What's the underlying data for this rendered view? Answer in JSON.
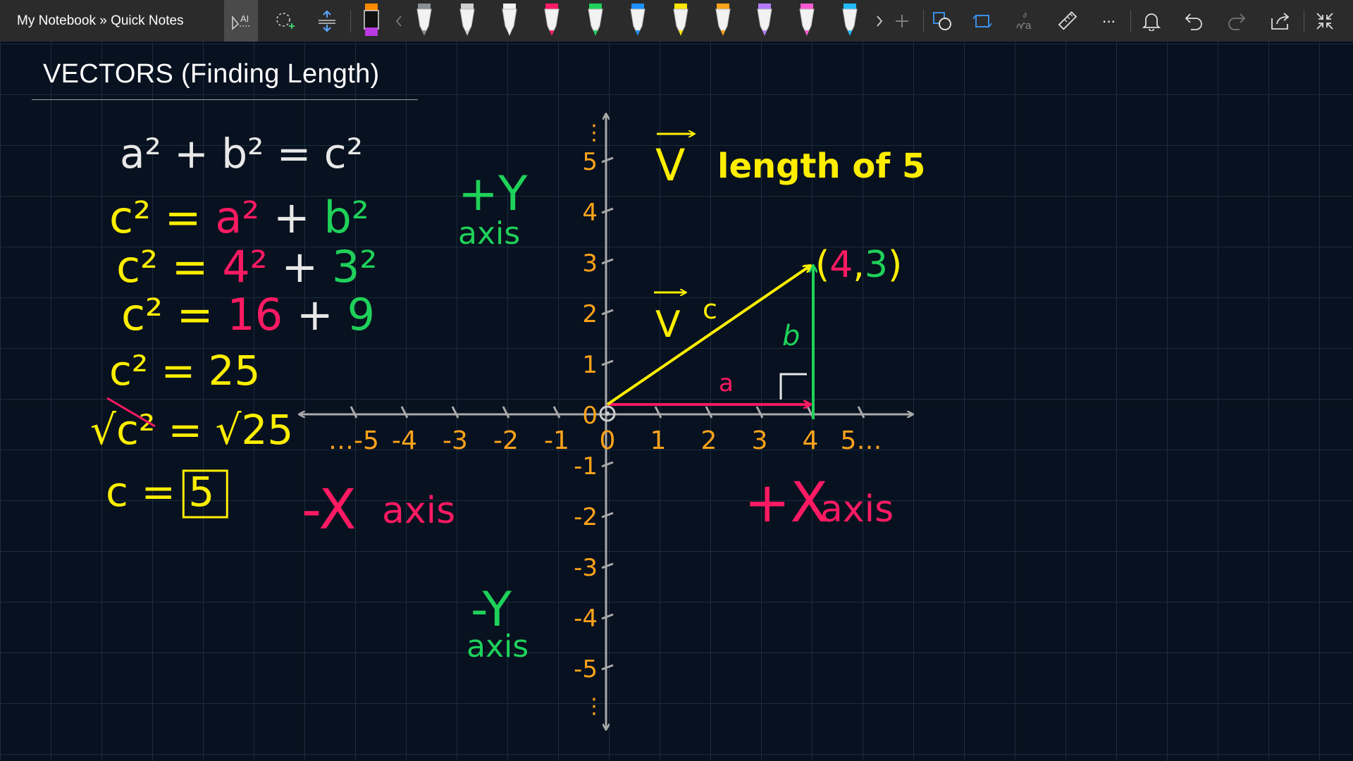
{
  "app": {
    "breadcrumb": "My Notebook » Quick Notes",
    "colors": {
      "toolbar_bg": "#2b2b2b",
      "canvas_bg": "#07111f",
      "grid_line": "#1c2c3d",
      "ink_white": "#e8e8e8",
      "ink_yellow": "#ffee00",
      "ink_pink": "#ff1a63",
      "ink_green": "#1fd15a",
      "ink_orange": "#ffa31a",
      "axis_gray": "#a9a9a9"
    }
  },
  "toolbar": {
    "left_tools": [
      "ink-to-text-icon",
      "lasso-select-icon",
      "add-space-icon"
    ],
    "pens": [
      "pen-orange-icon",
      "pen-gray-icon",
      "pen-white-icon",
      "pen-black-icon",
      "pen-pink-icon",
      "pen-green-icon",
      "pen-blue-icon",
      "pen-yellow-icon",
      "pen-orange2-icon",
      "pen-purple-icon",
      "pen-magenta-icon",
      "pen-cyan-icon"
    ],
    "right_tools": [
      "add-pen-icon",
      "shapes-icon",
      "ink-to-shape-icon",
      "ink-to-math-icon",
      "ruler-icon",
      "more-icon",
      "bell-icon",
      "undo-icon",
      "redo-icon",
      "share-icon",
      "fullscreen-exit-icon"
    ],
    "more_label": "···"
  },
  "page": {
    "title": "VECTORS (Finding Length)"
  },
  "work": {
    "lines": [
      [
        {
          "t": "a² + b² = c²",
          "c": "white"
        }
      ],
      [
        {
          "t": "c² = ",
          "c": "yellow"
        },
        {
          "t": "a²",
          "c": "pink"
        },
        {
          "t": " + ",
          "c": "white"
        },
        {
          "t": "b²",
          "c": "green"
        }
      ],
      [
        {
          "t": "c² = ",
          "c": "yellow"
        },
        {
          "t": "4²",
          "c": "pink"
        },
        {
          "t": " + ",
          "c": "white"
        },
        {
          "t": "3²",
          "c": "green"
        }
      ],
      [
        {
          "t": "c² = ",
          "c": "yellow"
        },
        {
          "t": "16",
          "c": "pink"
        },
        {
          "t": " + ",
          "c": "white"
        },
        {
          "t": "9",
          "c": "green"
        }
      ],
      [
        {
          "t": "c² = 25",
          "c": "yellow"
        }
      ],
      [
        {
          "t": "√c² = √25",
          "c": "yellow"
        }
      ],
      [
        {
          "t": "c = ",
          "c": "yellow"
        },
        {
          "t": "5",
          "c": "yellow",
          "boxed": true
        }
      ]
    ]
  },
  "graph": {
    "x_ticks": [
      "-5",
      "-4",
      "-3",
      "-2",
      "-1",
      "0",
      "1",
      "2",
      "3",
      "4",
      "5"
    ],
    "x_ticks_display": [
      "…-5",
      "-4",
      "-3",
      "-2",
      "-1",
      "0",
      "1",
      "2",
      "3",
      "4",
      "5…"
    ],
    "y_ticks": [
      "5",
      "4",
      "3",
      "2",
      "1",
      "0",
      "-1",
      "-2",
      "-3",
      "-4",
      "-5"
    ],
    "y_ellipsis": "⋮",
    "plus_y": "+Y",
    "plus_y_sub": "axis",
    "minus_y": "-Y",
    "minus_y_sub": "axis",
    "minus_x": "-X",
    "minus_x_sub": "axis",
    "plus_x": "+X",
    "plus_x_sub": "axis",
    "vector_heading_symbol": "V",
    "vector_heading_text": "length of 5",
    "point_label_open": "(",
    "point_label_x": "4",
    "point_label_comma": ",",
    "point_label_y": "3",
    "point_label_close": ")",
    "point": {
      "x": 4,
      "y": 3
    },
    "label_a": "a",
    "label_b": "b",
    "label_c": "c",
    "label_v": "V"
  }
}
